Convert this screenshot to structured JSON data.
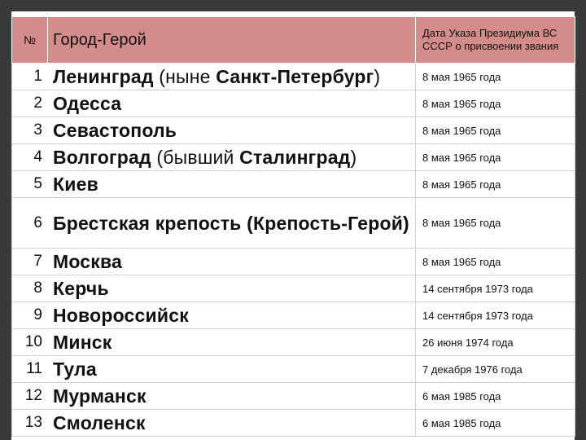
{
  "header": {
    "num": "№",
    "city": "Город-Герой",
    "date": "Дата Указа Президиума ВС СССР о присвоении звания"
  },
  "rows": [
    {
      "num": "1",
      "city_bold": "Ленинград",
      "city_plain": " (ныне ",
      "city_bold2": "Санкт-Петербург",
      "city_plain2": ")",
      "date": "8 мая 1965 года"
    },
    {
      "num": "2",
      "city_bold": "Одесса",
      "city_plain": "",
      "city_bold2": "",
      "city_plain2": "",
      "date": "8 мая 1965 года"
    },
    {
      "num": "3",
      "city_bold": "Севастополь",
      "city_plain": "",
      "city_bold2": "",
      "city_plain2": "",
      "date": "8 мая 1965 года"
    },
    {
      "num": "4",
      "city_bold": "Волгоград",
      "city_plain": " (бывший ",
      "city_bold2": "Сталинград",
      "city_plain2": ")",
      "date": "8 мая 1965 года"
    },
    {
      "num": "5",
      "city_bold": "Киев",
      "city_plain": "",
      "city_bold2": "",
      "city_plain2": "",
      "date": "8 мая 1965 года"
    },
    {
      "num": "6",
      "city_bold": "Брестская крепость (Крепость-Герой)",
      "city_plain": "",
      "city_bold2": "",
      "city_plain2": "",
      "date": "8 мая 1965 года"
    },
    {
      "num": "7",
      "city_bold": "Москва",
      "city_plain": "",
      "city_bold2": "",
      "city_plain2": "",
      "date": "8 мая 1965 года"
    },
    {
      "num": "8",
      "city_bold": "Керчь",
      "city_plain": "",
      "city_bold2": "",
      "city_plain2": "",
      "date": "14 сентября 1973 года"
    },
    {
      "num": "9",
      "city_bold": "Новороссийск",
      "city_plain": "",
      "city_bold2": "",
      "city_plain2": "",
      "date": "14 сентября 1973 года"
    },
    {
      "num": "10",
      "city_bold": "Минск",
      "city_plain": "",
      "city_bold2": "",
      "city_plain2": "",
      "date": "26 июня 1974 года"
    },
    {
      "num": "11",
      "city_bold": "Тула",
      "city_plain": "",
      "city_bold2": "",
      "city_plain2": "",
      "date": "7 декабря 1976 года"
    },
    {
      "num": "12",
      "city_bold": "Мурманск",
      "city_plain": "",
      "city_bold2": "",
      "city_plain2": "",
      "date": "6 мая 1985 года"
    },
    {
      "num": "13",
      "city_bold": "Смоленск",
      "city_plain": "",
      "city_bold2": "",
      "city_plain2": "",
      "date": "6 мая 1985 года"
    }
  ],
  "colors": {
    "header_bg": "#d38c89",
    "frame": "#3a3a3a"
  }
}
